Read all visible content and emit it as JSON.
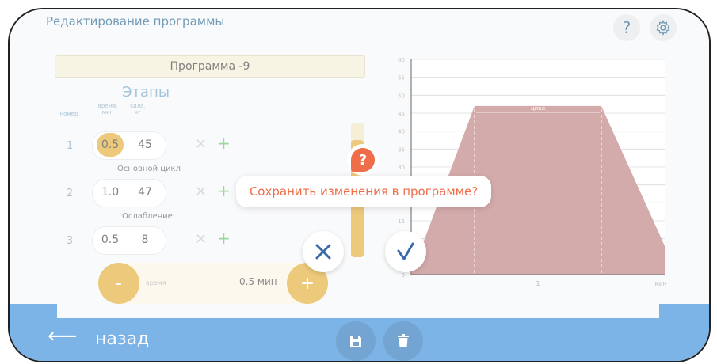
{
  "header": {
    "title": "Редактирование программы",
    "help_label": "?"
  },
  "program": {
    "name": "Программа -9"
  },
  "stages": {
    "title": "Этапы",
    "col_num": "номер",
    "col_time": "время, мин",
    "col_force": "сила, кг",
    "rows": [
      {
        "num": "1",
        "time": "0.5",
        "force": "45"
      },
      {
        "num": "2",
        "time": "1.0",
        "force": "47"
      },
      {
        "num": "3",
        "time": "0.5",
        "force": "8"
      }
    ],
    "labels": [
      "Основной цикл",
      "Ослабление"
    ],
    "delete_glyph": "✕",
    "add_glyph": "+"
  },
  "time_control": {
    "minus": "-",
    "plus": "+",
    "label": "время",
    "value": "0.5 мин"
  },
  "chart_data": {
    "type": "area",
    "x": [
      0,
      0.5,
      1.5,
      2.0
    ],
    "y": [
      0,
      47,
      47,
      8
    ],
    "xlim": [
      0,
      2.0
    ],
    "ylim": [
      0,
      60
    ],
    "yticks": [
      "0",
      "5",
      "10",
      "15",
      "20",
      "25",
      "30",
      "35",
      "40",
      "45",
      "50",
      "55",
      "60"
    ],
    "xticks": [
      "1"
    ],
    "xunit": "мин",
    "annotation": "цикл",
    "grid": true,
    "fill_color": "#b87876"
  },
  "footer": {
    "back_label": "назад"
  },
  "dialog": {
    "icon_glyph": "?",
    "message": "Сохранить изменения в программе?"
  },
  "colors": {
    "accent": "#e0a92b",
    "bar": "#2c86d8",
    "alert": "#ef6d49",
    "cancel": "#3a6aa8",
    "confirm": "#3a6aa8"
  }
}
